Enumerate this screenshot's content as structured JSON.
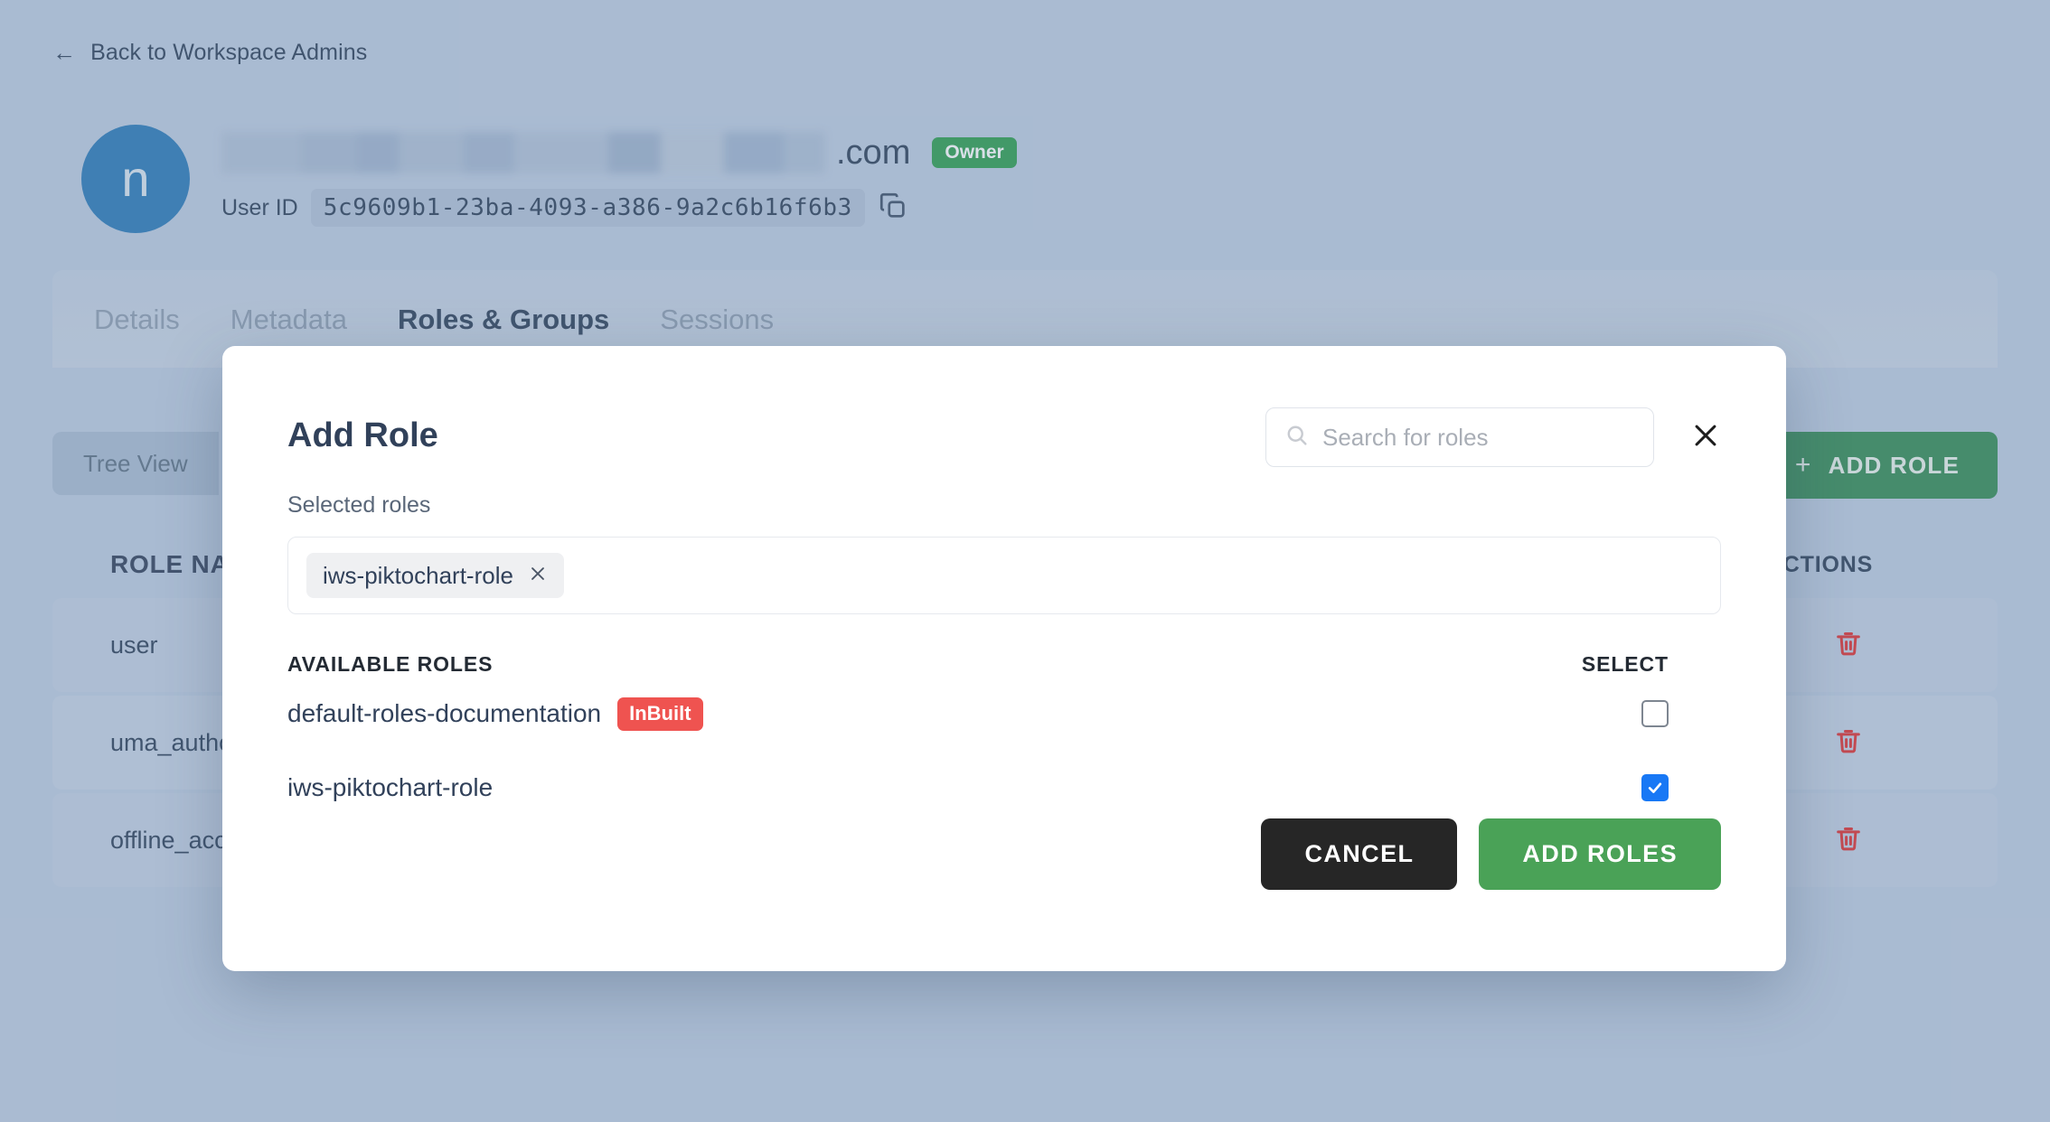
{
  "back_link": {
    "label": "Back to Workspace Admins",
    "icon": "arrow-left-icon"
  },
  "user": {
    "avatar_initial": "n",
    "email_domain_suffix": ".com",
    "owner_badge": "Owner",
    "userid_label": "User ID",
    "userid_value": "5c9609b1-23ba-4093-a386-9a2c6b16f6b3",
    "copy_icon": "copy-icon"
  },
  "tabs": [
    {
      "label": "Details",
      "active": false
    },
    {
      "label": "Metadata",
      "active": false
    },
    {
      "label": "Roles & Groups",
      "active": true
    },
    {
      "label": "Sessions",
      "active": false
    }
  ],
  "toolbar": {
    "tree_view_label": "Tree View",
    "add_role_label": "ADD ROLE",
    "add_role_icon": "plus-icon"
  },
  "table": {
    "columns": {
      "role_name": "ROLE NAME",
      "actions": "ACTIONS"
    },
    "rows": [
      {
        "role_name": "user",
        "action_icon": "trash-icon"
      },
      {
        "role_name": "uma_authorization",
        "action_icon": "trash-icon"
      },
      {
        "role_name": "offline_access",
        "action_icon": "trash-icon"
      }
    ]
  },
  "modal": {
    "title": "Add Role",
    "close_icon": "close-icon",
    "search": {
      "icon": "search-icon",
      "placeholder": "Search for roles",
      "value": ""
    },
    "selected_roles_label": "Selected roles",
    "selected_roles": [
      {
        "label": "iws-piktochart-role",
        "remove_icon": "close-icon"
      }
    ],
    "list_header": {
      "available": "AVAILABLE ROLES",
      "select": "SELECT"
    },
    "available_roles": [
      {
        "name": "default-roles-documentation",
        "badge": "InBuilt",
        "checked": false
      },
      {
        "name": "iws-piktochart-role",
        "badge": "",
        "checked": true
      }
    ],
    "cancel_label": "CANCEL",
    "submit_label": "ADD ROLES"
  },
  "colors": {
    "page_background": "#bdcde2",
    "avatar": "#2a7ab9",
    "owner_badge": "#2e9e4f",
    "add_role_button": "#348c55",
    "submit_button": "#4aa257",
    "cancel_button": "#262626",
    "inbuilt_badge": "#ef5350",
    "checkbox_checked": "#1878f5",
    "trash_icon": "#e03131",
    "text_primary": "#2d4159"
  }
}
